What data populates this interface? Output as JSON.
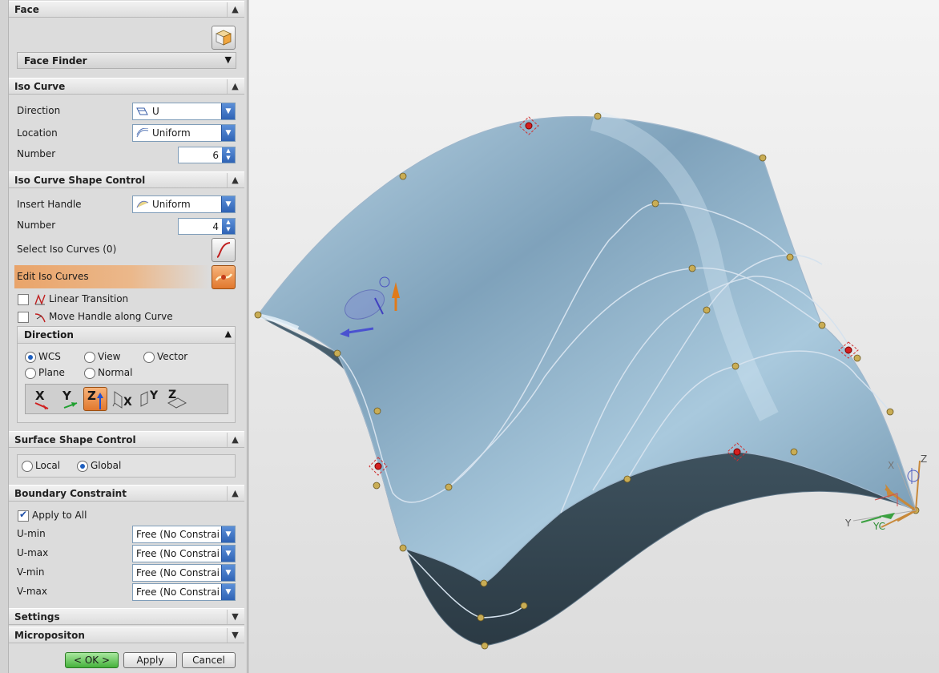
{
  "panel": {
    "face": {
      "title": "Face",
      "finder": "Face Finder"
    },
    "iso_curve": {
      "title": "Iso Curve",
      "direction_label": "Direction",
      "direction_value": "U",
      "location_label": "Location",
      "location_value": "Uniform",
      "number_label": "Number",
      "number_value": "6"
    },
    "shape_control": {
      "title": "Iso Curve Shape Control",
      "insert_handle_label": "Insert Handle",
      "insert_handle_value": "Uniform",
      "number_label": "Number",
      "number_value": "4",
      "select_label": "Select Iso Curves (0)",
      "edit_label": "Edit Iso Curves",
      "linear_transition": "Linear Transition",
      "move_handle": "Move Handle along Curve",
      "direction": {
        "title": "Direction",
        "wcs": "WCS",
        "view": "View",
        "vector": "Vector",
        "plane": "Plane",
        "normal": "Normal",
        "axes": [
          "X",
          "Y",
          "Z",
          "X",
          "Y",
          "Z"
        ]
      }
    },
    "surface_shape": {
      "title": "Surface Shape Control",
      "local": "Local",
      "global": "Global"
    },
    "boundary": {
      "title": "Boundary Constraint",
      "apply_all": "Apply to All",
      "rows": [
        {
          "label": "U-min",
          "value": "Free (No Constraint)"
        },
        {
          "label": "U-max",
          "value": "Free (No Constraint)"
        },
        {
          "label": "V-min",
          "value": "Free (No Constraint)"
        },
        {
          "label": "V-max",
          "value": "Free (No Constraint)"
        }
      ]
    },
    "settings": "Settings",
    "microposition": "Micropositon",
    "buttons": {
      "ok": "< OK >",
      "apply": "Apply",
      "cancel": "Cancel"
    }
  },
  "viewport": {
    "triad": {
      "x": "X",
      "y": "Y",
      "z": "Z",
      "yc": "YC"
    },
    "colors": {
      "surface": "#8fb4cc",
      "surface_dark": "#3b4f5c",
      "handle": "#c9ad55",
      "selected_handle": "#d42020"
    }
  }
}
